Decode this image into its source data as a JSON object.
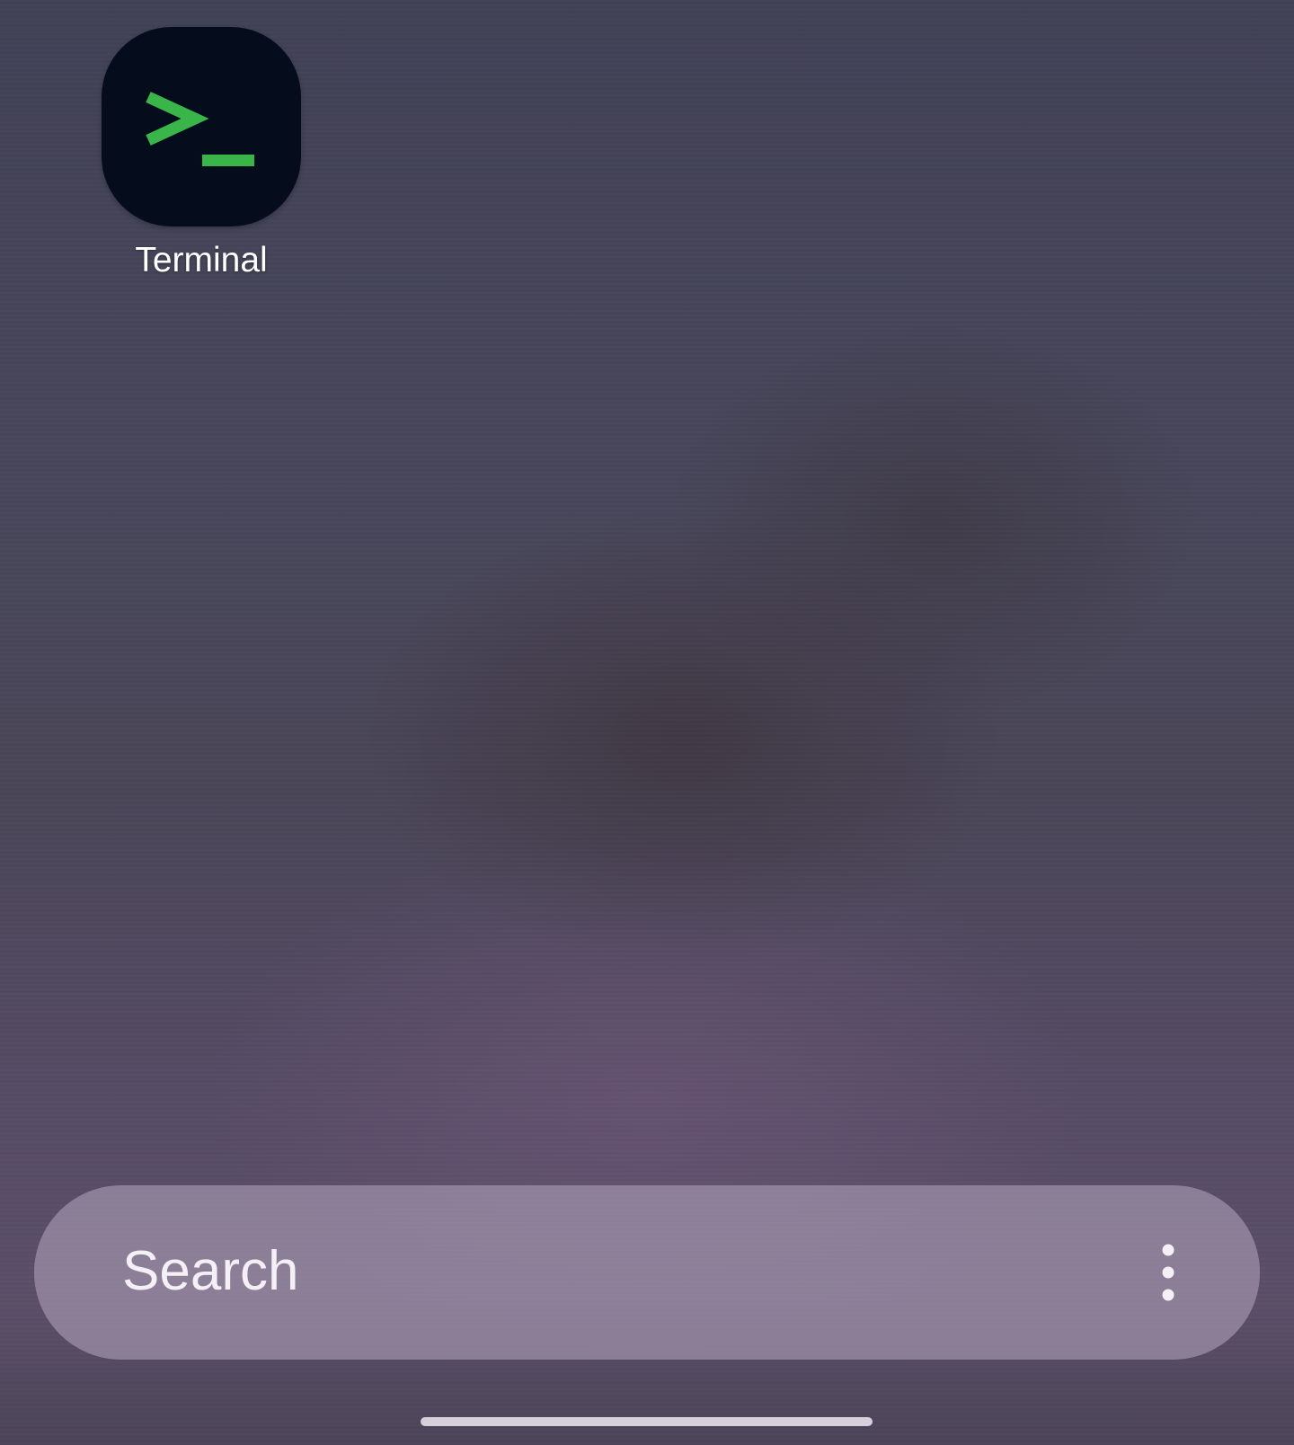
{
  "home_screen": {
    "apps": [
      {
        "label": "Terminal",
        "icon": "terminal-icon",
        "icon_background": "#050c1c",
        "icon_glyph_color": "#3ab54a"
      }
    ]
  },
  "search": {
    "placeholder": "Search",
    "more_icon": "more-vert-icon"
  },
  "colors": {
    "wallpaper_top": "#424257",
    "wallpaper_bottom": "#5b4f68",
    "search_bar": "#a092aa",
    "text": "#ffffff"
  }
}
